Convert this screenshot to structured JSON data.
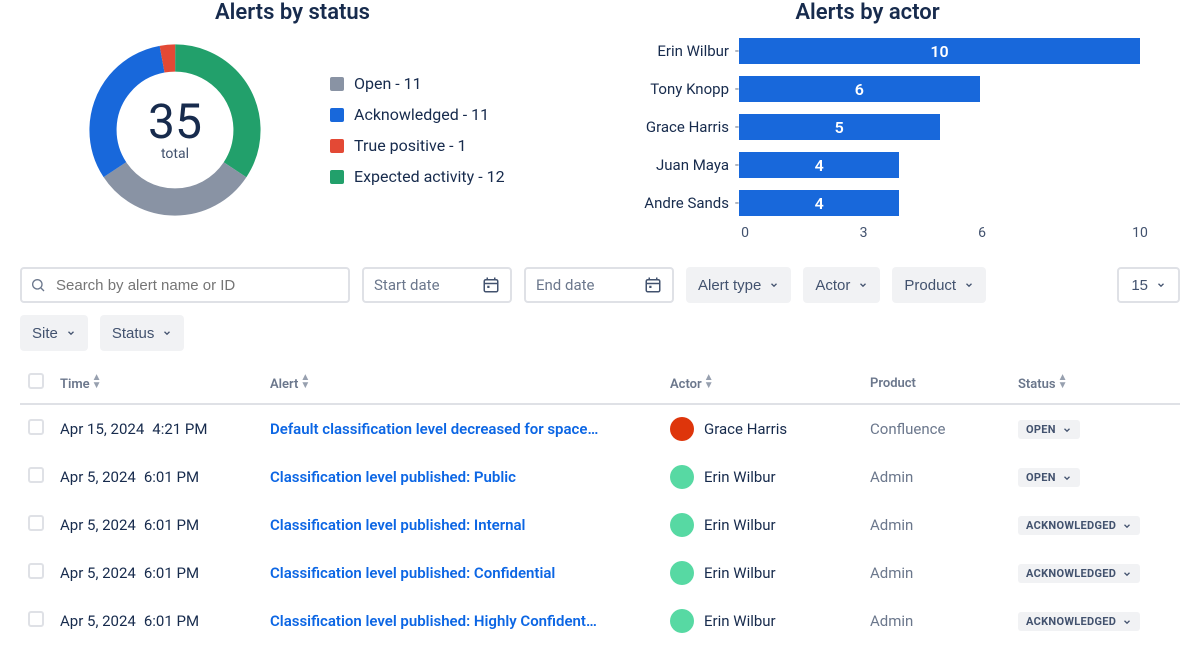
{
  "donut": {
    "title": "Alerts by status",
    "total": "35",
    "total_label": "total",
    "items": [
      {
        "label": "Open - 11",
        "color": "#8993A4"
      },
      {
        "label": "Acknowledged - 11",
        "color": "#1868DB"
      },
      {
        "label": "True positive - 1",
        "color": "#E34935"
      },
      {
        "label": "Expected activity - 12",
        "color": "#22A06B"
      }
    ]
  },
  "chart_data": {
    "donut": {
      "type": "pie",
      "title": "Alerts by status",
      "categories": [
        "Open",
        "Acknowledged",
        "True positive",
        "Expected activity"
      ],
      "values": [
        11,
        11,
        1,
        12
      ],
      "colors": [
        "#8993A4",
        "#1868DB",
        "#E34935",
        "#22A06B"
      ],
      "center_total": 35
    },
    "bars": {
      "type": "bar",
      "title": "Alerts by actor",
      "orientation": "horizontal",
      "categories": [
        "Erin Wilbur",
        "Tony Knopp",
        "Grace Harris",
        "Juan Maya",
        "Andre Sands"
      ],
      "values": [
        10,
        6,
        5,
        4,
        4
      ],
      "xlim": [
        0,
        10
      ],
      "ticks": [
        0,
        3,
        6,
        10
      ],
      "color": "#1868DB"
    }
  },
  "bars": {
    "title": "Alerts by actor"
  },
  "filters": {
    "search_placeholder": "Search by alert name or ID",
    "start_date": "Start date",
    "end_date": "End date",
    "alert_type": "Alert type",
    "actor": "Actor",
    "product": "Product",
    "page_size": "15",
    "site": "Site",
    "status": "Status"
  },
  "table": {
    "headers": {
      "time": "Time",
      "alert": "Alert",
      "actor": "Actor",
      "product": "Product",
      "status": "Status"
    },
    "rows": [
      {
        "date": "Apr 15, 2024",
        "time": "4:21 PM",
        "alert": "Default classification level decreased for space…",
        "actor": "Grace Harris",
        "avatar": "#DE350B",
        "product": "Confluence",
        "status": "OPEN"
      },
      {
        "date": "Apr 5, 2024",
        "time": "6:01 PM",
        "alert": "Classification level published: Public",
        "actor": "Erin Wilbur",
        "avatar": "#57D9A3",
        "product": "Admin",
        "status": "OPEN"
      },
      {
        "date": "Apr 5, 2024",
        "time": "6:01 PM",
        "alert": "Classification level published: Internal",
        "actor": "Erin Wilbur",
        "avatar": "#57D9A3",
        "product": "Admin",
        "status": "ACKNOWLEDGED"
      },
      {
        "date": "Apr 5, 2024",
        "time": "6:01 PM",
        "alert": "Classification level published: Confidential",
        "actor": "Erin Wilbur",
        "avatar": "#57D9A3",
        "product": "Admin",
        "status": "ACKNOWLEDGED"
      },
      {
        "date": "Apr 5, 2024",
        "time": "6:01 PM",
        "alert": "Classification level published: Highly Confident…",
        "actor": "Erin Wilbur",
        "avatar": "#57D9A3",
        "product": "Admin",
        "status": "ACKNOWLEDGED"
      }
    ]
  }
}
